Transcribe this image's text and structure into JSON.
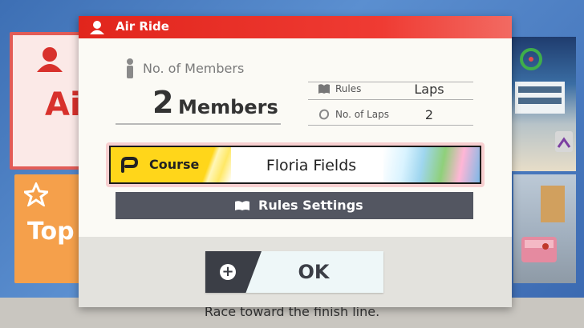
{
  "background": {
    "tiles": [
      {
        "label": "Air",
        "icon": "air-ride-icon"
      },
      {
        "label": "Top",
        "icon": "star-icon"
      }
    ],
    "description": "Race toward the finish line."
  },
  "modal": {
    "title": "Air Ride",
    "title_icon": "air-ride-icon",
    "members": {
      "label": "No. of Members",
      "count": "2",
      "unit": "Members"
    },
    "rules": [
      {
        "icon": "book-icon",
        "label": "Rules",
        "value": "Laps"
      },
      {
        "icon": "lap-icon",
        "label": "No. of Laps",
        "value": "2"
      }
    ],
    "course": {
      "label": "Course",
      "value": "Floria Fields"
    },
    "rules_settings_label": "Rules Settings",
    "ok_label": "OK",
    "ok_button_icon": "plus-button-icon"
  },
  "colors": {
    "header_red": "#e1251c",
    "course_yellow": "#ffd61a",
    "button_dark": "#535661"
  }
}
